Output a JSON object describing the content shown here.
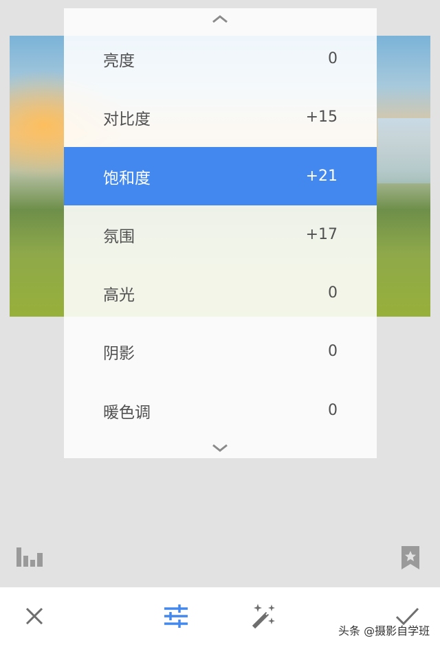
{
  "adjustments": [
    {
      "label": "亮度",
      "value": "0"
    },
    {
      "label": "对比度",
      "value": "+15"
    },
    {
      "label": "饱和度",
      "value": "+21"
    },
    {
      "label": "氛围",
      "value": "+17"
    },
    {
      "label": "高光",
      "value": "0"
    },
    {
      "label": "阴影",
      "value": "0"
    },
    {
      "label": "暖色调",
      "value": "0"
    }
  ],
  "selected_adjustment": "饱和度",
  "colors": {
    "selected_row": "#4288ef",
    "active_tool": "#4288ef",
    "icon_gray": "#6e6e6e"
  },
  "watermark": "头条 @摄影自学班",
  "icons": {
    "scroll_up": "chevron-up-icon",
    "scroll_down": "chevron-down-icon",
    "histogram": "histogram-icon",
    "styles": "bookmark-star-icon",
    "cancel": "close-icon",
    "tune": "tune-sliders-icon",
    "auto": "magic-wand-icon",
    "apply": "check-icon"
  }
}
